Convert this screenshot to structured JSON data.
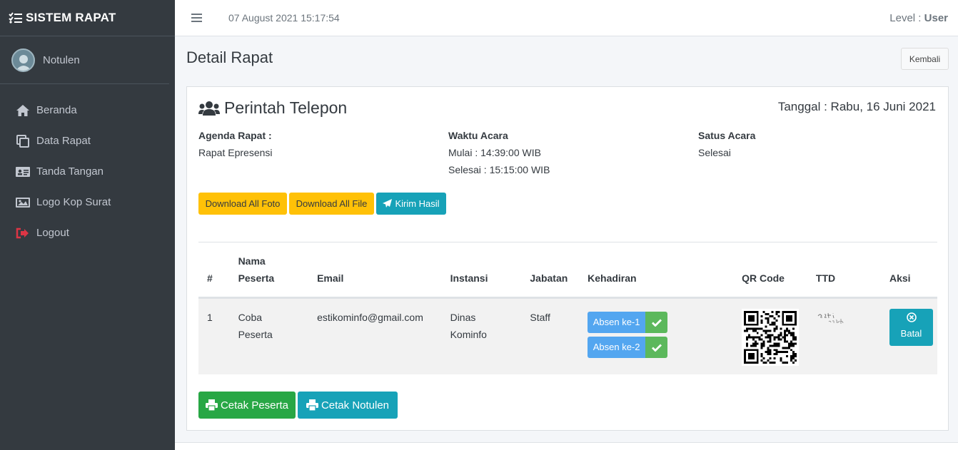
{
  "brand": {
    "title": "SISTEM RAPAT"
  },
  "user": {
    "name": "Notulen"
  },
  "sidebar": {
    "items": [
      {
        "label": "Beranda",
        "icon": "home-icon"
      },
      {
        "label": "Data Rapat",
        "icon": "copy-icon"
      },
      {
        "label": "Tanda Tangan",
        "icon": "id-card-icon"
      },
      {
        "label": "Logo Kop Surat",
        "icon": "image-icon"
      },
      {
        "label": "Logout",
        "icon": "logout-icon"
      }
    ]
  },
  "topbar": {
    "datetime": "07 August 2021 15:17:54",
    "level_label": "Level : ",
    "level_value": "User"
  },
  "page": {
    "title": "Detail Rapat",
    "back_label": "Kembali"
  },
  "meeting": {
    "title": "Perintah Telepon",
    "date": "Tanggal : Rabu, 16 Juni 2021",
    "agenda_label": "Agenda Rapat :",
    "agenda_value": "Rapat Epresensi",
    "time_label": "Waktu Acara",
    "start": "Mulai : 14:39:00 WIB",
    "end": "Selesai : 15:15:00 WIB",
    "status_label": "Satus Acara",
    "status_value": "Selesai"
  },
  "actions": {
    "download_foto": "Download All Foto",
    "download_file": "Download All File",
    "kirim_hasil": "Kirim Hasil"
  },
  "table": {
    "headers": [
      "#",
      "Nama Peserta",
      "Email",
      "Instansi",
      "Jabatan",
      "Kehadiran",
      "QR Code",
      "TTD",
      "Aksi"
    ],
    "rows": [
      {
        "no": "1",
        "nama": "Coba Peserta",
        "email": "estikominfo@gmail.com",
        "instansi": "Dinas Kominfo",
        "jabatan": "Staff",
        "absen1": "Absen ke-1",
        "absen2": "Absen ke-2",
        "batal": "Batal"
      }
    ]
  },
  "footer_actions": {
    "cetak_peserta": "Cetak Peserta",
    "cetak_notulen": "Cetak Notulen"
  },
  "colors": {
    "sidebar": "#343a40",
    "warning": "#ffc107",
    "info": "#17a2b8",
    "success": "#28a745",
    "absen": "#53a6f0",
    "check": "#5cb85c"
  }
}
